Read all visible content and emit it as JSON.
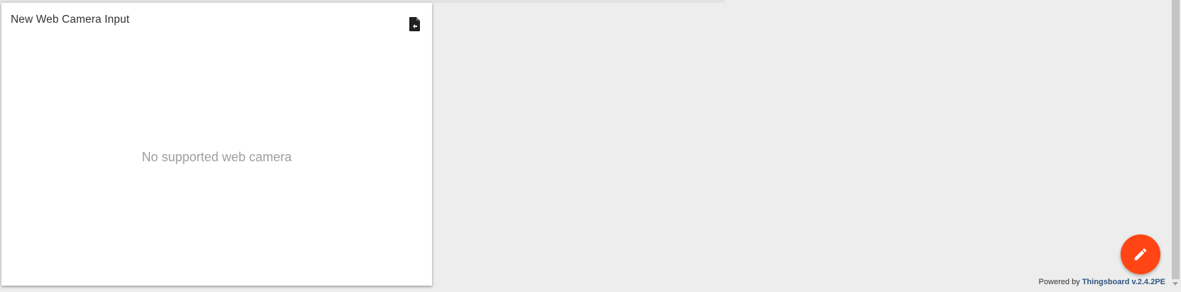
{
  "widget": {
    "title": "New Web Camera Input",
    "action_icon": "file-export-icon",
    "message": "No supported web camera"
  },
  "fab": {
    "icon": "edit-pencil-icon",
    "color": "#ff4513"
  },
  "footer": {
    "prefix": "Powered by",
    "link_text": "Thingsboard v.2.4.2PE",
    "link_color": "#305680"
  }
}
